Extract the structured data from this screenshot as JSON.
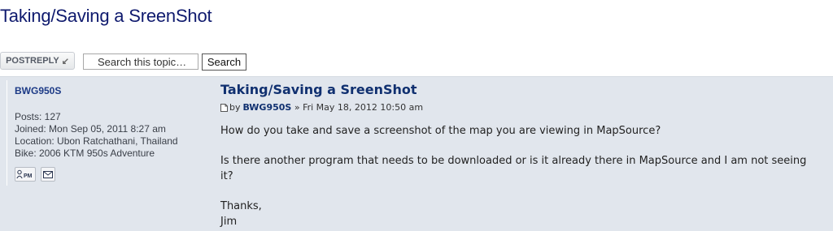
{
  "page": {
    "title": "Taking/Saving a SreenShot"
  },
  "toolbar": {
    "postreply_bold": "POSTREPLY",
    "postreply_arrow": "↙",
    "search_value": "Search this topic…",
    "search_label": "Search"
  },
  "post": {
    "title": "Taking/Saving a SreenShot",
    "by_label": "by",
    "author": "BWG950S",
    "date": "» Fri May 18, 2012 10:50 am",
    "paragraphs": [
      "How do you take and save a screenshot of the map you are viewing in MapSource?",
      "Is there another program that needs to be downloaded or is it already there in MapSource and I am not seeing it?"
    ],
    "signoff": "Thanks,",
    "signature": "Jim"
  },
  "profile": {
    "username": "BWG950S",
    "posts": "Posts: 127",
    "joined": "Joined: Mon Sep 05, 2011 8:27 am",
    "location": "Location: Ubon Ratchathani, Thailand",
    "bike": "Bike: 2006 KTM 950s Adventure",
    "pm_label": "PM"
  },
  "icons": [
    "post-icon",
    "pm-icon",
    "email-icon",
    "reply-arrow-icon"
  ]
}
